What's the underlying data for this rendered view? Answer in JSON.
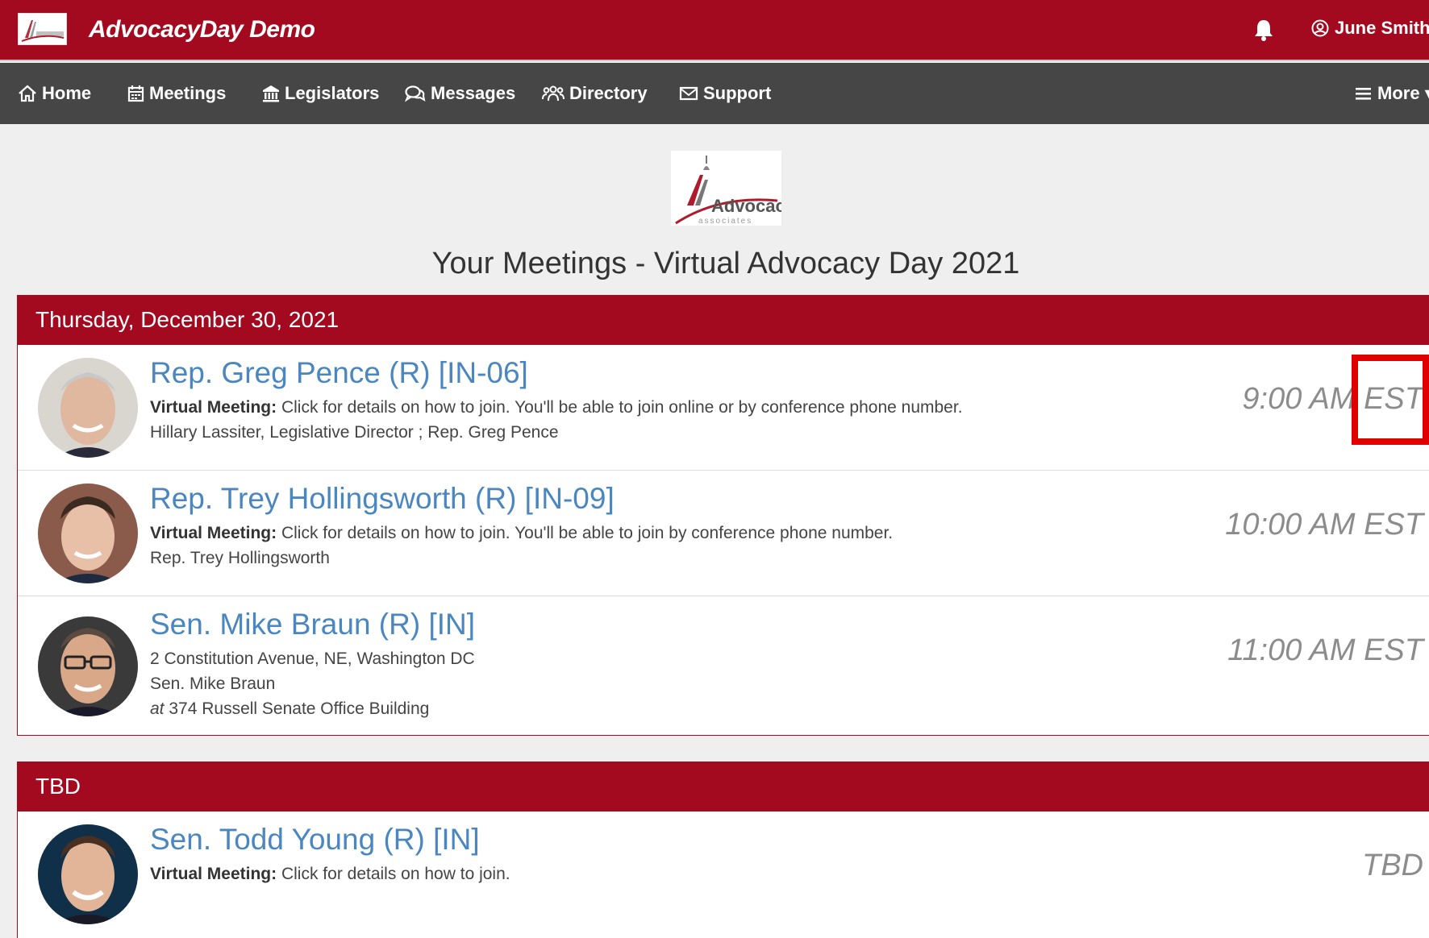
{
  "header": {
    "app_title": "AdvocacyDay Demo",
    "user_name": "June Smith",
    "logo_alt": "Advocacy"
  },
  "nav": {
    "items": [
      {
        "label": "Home",
        "icon": "home-icon"
      },
      {
        "label": "Meetings",
        "icon": "calendar-icon"
      },
      {
        "label": "Legislators",
        "icon": "bank-icon"
      },
      {
        "label": "Messages",
        "icon": "chat-icon"
      },
      {
        "label": "Directory",
        "icon": "users-icon"
      },
      {
        "label": "Support",
        "icon": "envelope-icon"
      }
    ],
    "more_label": "More"
  },
  "page": {
    "logo_text": "Advocacy",
    "logo_subtext": "associates",
    "title": "Your Meetings - Virtual Advocacy Day 2021"
  },
  "sections": [
    {
      "header": "Thursday, December 30, 2021",
      "meetings": [
        {
          "title": "Rep. Greg Pence (R) [IN-06]",
          "detail_label": "Virtual Meeting:",
          "detail_text": " Click for details on how to join. You'll be able to join online or by conference phone number.",
          "attendees": "Hillary Lassiter, Legislative Director ; Rep. Greg Pence",
          "time": "9:00 AM EST"
        },
        {
          "title": "Rep. Trey Hollingsworth (R) [IN-09]",
          "detail_label": "Virtual Meeting:",
          "detail_text": " Click for details on how to join. You'll be able to join by conference phone number.",
          "attendees": "Rep. Trey Hollingsworth",
          "time": "10:00 AM EST"
        },
        {
          "title": "Sen. Mike Braun (R) [IN]",
          "address": "2 Constitution Avenue, NE, Washington DC",
          "attendees": "Sen. Mike Braun",
          "location_prefix": "at",
          "location": " 374 Russell Senate Office Building",
          "time": "11:00 AM EST"
        }
      ]
    },
    {
      "header": "TBD",
      "meetings": [
        {
          "title": "Sen. Todd Young (R) [IN]",
          "detail_label": "Virtual Meeting:",
          "detail_text": " Click for details on how to join.",
          "time": "TBD"
        }
      ]
    }
  ],
  "colors": {
    "brand_red": "#a3091f",
    "nav_gray": "#464646",
    "link_blue": "#4a86c0",
    "highlight": "#e00000"
  }
}
